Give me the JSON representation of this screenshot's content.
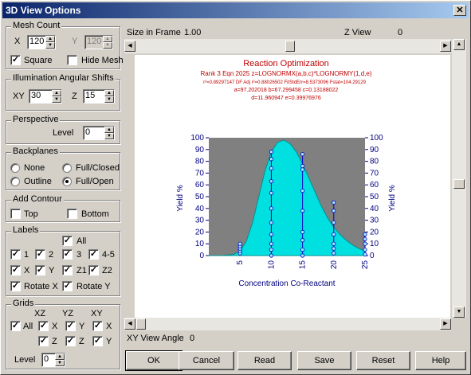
{
  "window": {
    "title": "3D View Options",
    "close_glyph": "✕"
  },
  "mesh_count": {
    "title": "Mesh Count",
    "x_label": "X",
    "x_value": "120",
    "y_label": "Y",
    "y_value": "120",
    "square_label": "Square",
    "square_checked": true,
    "hide_mesh_label": "Hide Mesh",
    "hide_mesh_checked": false
  },
  "illumination": {
    "title": "Illumination Angular Shifts",
    "xy_label": "XY",
    "xy_value": "30",
    "z_label": "Z",
    "z_value": "15"
  },
  "perspective": {
    "title": "Perspective",
    "level_label": "Level",
    "level_value": "0"
  },
  "backplanes": {
    "title": "Backplanes",
    "options": [
      "None",
      "Full/Closed",
      "Outline",
      "Full/Open"
    ],
    "selected": "Full/Open"
  },
  "add_contour": {
    "title": "Add Contour",
    "top_label": "Top",
    "bottom_label": "Bottom"
  },
  "labels": {
    "title": "Labels",
    "all": "All",
    "l1": "1",
    "l2": "2",
    "l3": "3",
    "l45": "4-5",
    "x": "X",
    "y": "Y",
    "z1": "Z1",
    "z2": "Z2",
    "rotate_x": "Rotate X",
    "rotate_y": "Rotate Y"
  },
  "grids": {
    "title": "Grids",
    "col_xz": "XZ",
    "col_yz": "YZ",
    "col_xy": "XY",
    "all": "All",
    "x": "X",
    "y": "Y",
    "z": "Z",
    "level_label": "Level",
    "level_value": "0"
  },
  "view": {
    "size_label": "Size in Frame",
    "size_value": "1.00",
    "zview_label": "Z View",
    "zview_value": "0",
    "xy_angle_label": "XY View Angle",
    "xy_angle_value": "0"
  },
  "buttons": {
    "ok": "OK",
    "cancel": "Cancel",
    "read": "Read",
    "save": "Save",
    "reset": "Reset",
    "help": "Help"
  },
  "chart_data": {
    "type": "area",
    "title": "Reaction Optimization",
    "subtitle": "Rank 3   Eqn 2025   z=LOGNORMX(a,b,c)*LOGNORMY(1,d,e)",
    "stats_line": "r²=0.89297147  DF Adj r²=0.88026502  FitStdErr=8.5373096  Fstat=104.29129",
    "params_line1": "a=97.202018 b=67.299458 c=0.13188022",
    "params_line2": "d=11.960947 e=0.39976976",
    "xlabel": "Concentration Co-Reactant",
    "ylabel": "Yield %",
    "ylabel_right": "Yield %",
    "xlim": [
      0,
      25
    ],
    "ylim": [
      0,
      100
    ],
    "x_ticks": [
      "5",
      "10",
      "15",
      "20",
      "25"
    ],
    "y_ticks": [
      "0",
      "10",
      "20",
      "30",
      "40",
      "50",
      "60",
      "70",
      "80",
      "90",
      "100"
    ],
    "surface_color": "#00e0e0",
    "backplane_color": "#808080",
    "curve": {
      "x": [
        0,
        2,
        4,
        5,
        6,
        7,
        8,
        9,
        10,
        11,
        12,
        13,
        14,
        15,
        16,
        17,
        18,
        19,
        20,
        21,
        22,
        23,
        24,
        25
      ],
      "y": [
        0,
        0,
        1,
        4,
        12,
        28,
        50,
        72,
        88,
        96,
        98,
        95,
        88,
        78,
        66,
        54,
        42,
        32,
        24,
        18,
        13,
        9,
        6,
        4
      ]
    },
    "point_columns": [
      {
        "x": 5,
        "y": [
          2,
          4,
          6,
          8,
          10
        ]
      },
      {
        "x": 10,
        "y": [
          0,
          5,
          10,
          18,
          28,
          40,
          53,
          63,
          74,
          82,
          88
        ]
      },
      {
        "x": 15,
        "y": [
          0,
          5,
          13,
          20,
          38,
          55,
          73,
          76,
          86
        ]
      },
      {
        "x": 20,
        "y": [
          2,
          6,
          10,
          18,
          28,
          38,
          45
        ]
      },
      {
        "x": 25,
        "y": [
          1,
          5,
          10,
          14,
          18
        ]
      }
    ]
  }
}
